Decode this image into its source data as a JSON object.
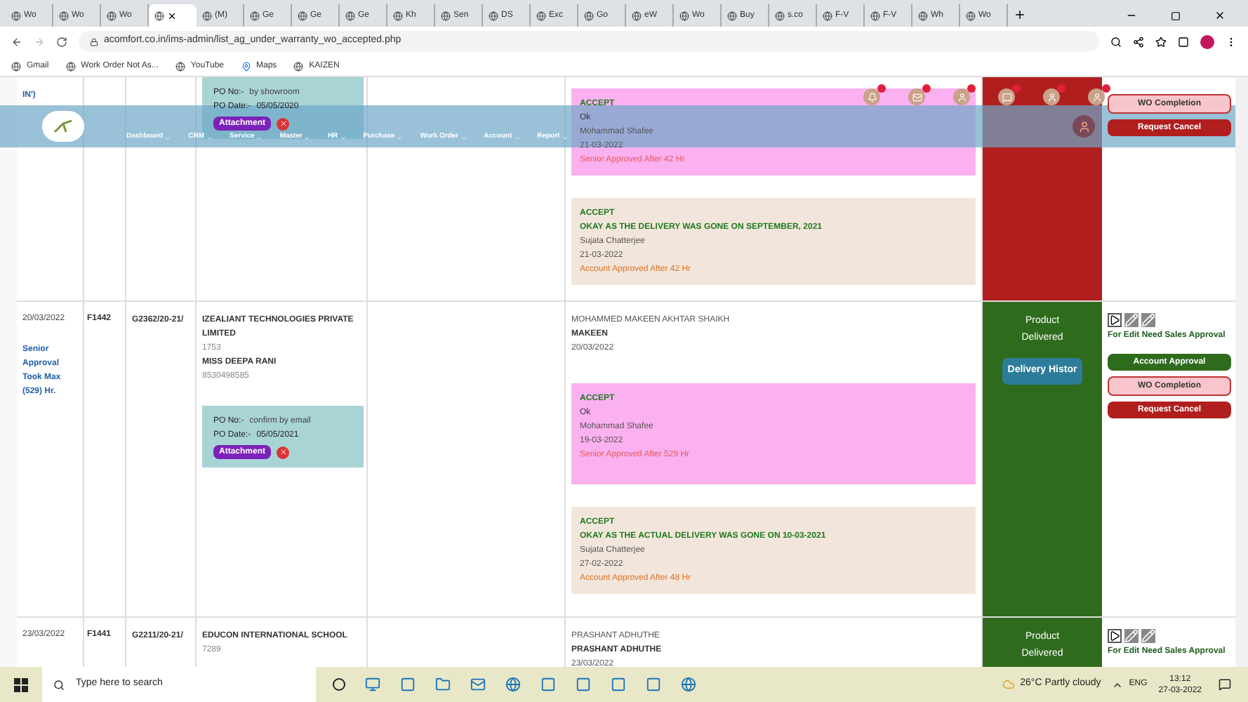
{
  "browser": {
    "tabs": [
      {
        "label": "Wo",
        "selected": false
      },
      {
        "label": "Wo",
        "selected": false
      },
      {
        "label": "Wo",
        "selected": false
      },
      {
        "selected": true
      },
      {
        "label": "(M)",
        "selected": false
      },
      {
        "label": "Ge",
        "selected": false
      },
      {
        "label": "Ge",
        "selected": false
      },
      {
        "label": "Ge",
        "selected": false
      },
      {
        "label": "Kh",
        "selected": false
      },
      {
        "label": "Sen",
        "selected": false
      },
      {
        "label": "DS",
        "selected": false
      },
      {
        "label": "Exc",
        "selected": false
      },
      {
        "label": "Go",
        "selected": false
      },
      {
        "label": "eW",
        "selected": false
      },
      {
        "label": "Wo",
        "selected": false
      },
      {
        "label": "Buy",
        "selected": false
      },
      {
        "label": "s.co",
        "selected": false
      },
      {
        "label": "F-V",
        "selected": false
      },
      {
        "label": "F-V",
        "selected": false
      },
      {
        "label": "Wh",
        "selected": false
      },
      {
        "label": "Wo",
        "selected": false
      }
    ],
    "address": "acomfort.co.in/ims-admin/list_ag_under_warranty_wo_accepted.php",
    "bookmarks": [
      "Gmail",
      "Work Order Not As...",
      "YouTube",
      "Maps",
      "KAIZEN"
    ]
  },
  "navbar": {
    "menu": [
      "Dashboard",
      "CRM",
      "Service",
      "Master",
      "HR",
      "Purchase",
      "Work Order",
      "Account",
      "Report"
    ]
  },
  "rows": [
    {
      "note": "IN')",
      "po_no_label": "PO No:-",
      "po_no": "by showroom",
      "po_date_label": "PO Date:-",
      "po_date": "05/05/2020",
      "attachment": "Attachment",
      "approvals": [
        {
          "kind": "senior",
          "head": "ACCEPT",
          "remark": "Ok",
          "by": "Mohammad Shafee",
          "on": "21-03-2022",
          "after": "Senior Approved After 42 Hr"
        },
        {
          "kind": "account",
          "head": "ACCEPT",
          "remark": "OKAY AS THE DELIVERY WAS GONE ON SEPTEMBER, 2021",
          "by": "Sujata Chatterjee",
          "on": "21-03-2022",
          "after": "Account Approved After 42 Hr"
        }
      ],
      "status": {
        "color": "#b01e1e"
      },
      "actions": {
        "buttons": [
          {
            "kind": "completion",
            "label": "WO Completion"
          },
          {
            "kind": "cancel",
            "label": "Request Cancel"
          }
        ]
      }
    },
    {
      "date": "20/03/2022",
      "note": "Senior Approval Took Max (529) Hr.",
      "f_no": "F1442",
      "g_no": "G2362/20-21/",
      "company": "IZEALIANT TECHNOLOGIES PRIVATE LIMITED",
      "code": "1753",
      "contact": "MISS DEEPA RANI",
      "phone": "8530498585",
      "po_no_label": "PO No:-",
      "po_no": "confirm by email",
      "po_date_label": "PO Date:-",
      "po_date": "05/05/2021",
      "attachment": "Attachment",
      "assignee": {
        "full": "MOHAMMED MAKEEN AKHTAR SHAIKH",
        "short": "MAKEEN",
        "date": "20/03/2022"
      },
      "approvals": [
        {
          "kind": "senior",
          "head": "ACCEPT",
          "remark": "Ok",
          "by": "Mohammad Shafee",
          "on": "19-03-2022",
          "after": "Senior Approved After 529 Hr"
        },
        {
          "kind": "account",
          "head": "ACCEPT",
          "remark": "OKAY AS THE ACTUAL DELIVERY WAS GONE ON 10-03-2021",
          "by": "Sujata Chatterjee",
          "on": "27-02-2022",
          "after": "Account Approved After 48 Hr"
        }
      ],
      "status": {
        "color": "#2e6b1c",
        "label": "Product Delivered",
        "button": "Delivery Histor"
      },
      "actions": {
        "note": "For Edit Need Sales Approval",
        "buttons": [
          {
            "kind": "account",
            "label": "Account Approval"
          },
          {
            "kind": "completion",
            "label": "WO Completion"
          },
          {
            "kind": "cancel",
            "label": "Request Cancel"
          }
        ]
      }
    },
    {
      "date": "23/03/2022",
      "f_no": "F1441",
      "g_no": "G2211/20-21/",
      "company": "EDUCON INTERNATIONAL SCHOOL",
      "code": "7289",
      "assignee": {
        "full": "PRASHANT ADHUTHE",
        "short": "PRASHANT ADHUTHE",
        "date": "23/03/2022"
      },
      "status": {
        "color": "#2e6b1c",
        "label": "Product Delivered"
      },
      "actions": {
        "note": "For Edit Need Sales Approval"
      }
    }
  ],
  "taskbar": {
    "search": "Type here to search",
    "weather": "26°C Partly cloudy",
    "lang": "ENG",
    "time": "13:12",
    "date": "27-03-2022"
  }
}
